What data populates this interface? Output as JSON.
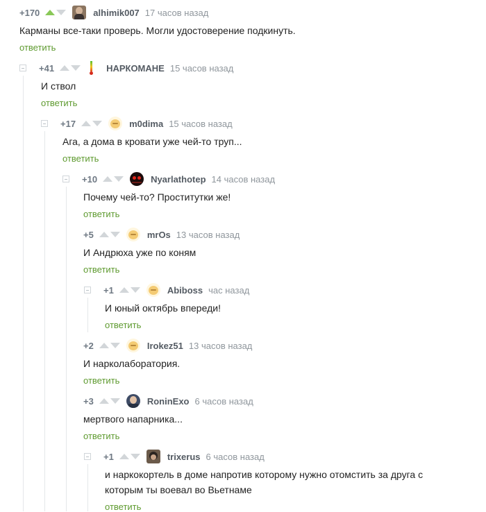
{
  "reply_label": "ответить",
  "colors": {
    "upvote_active": "#8ac858",
    "reply_link": "#5e9a2f",
    "branch_line": "#e4e7e9"
  },
  "comments": [
    {
      "rating": "+170",
      "author": "alhimik007",
      "time": "17 часов назад",
      "avatar": "photo-avatar",
      "upvoted": true,
      "lines": [
        "Карманы все-таки проверь. Могли удостоверение подкинуть."
      ]
    },
    {
      "rating": "+41",
      "author": "НАРКОМАНЕ",
      "time": "15 часов назад",
      "avatar": "thermometer-avatar",
      "lines": [
        "И ствол"
      ]
    },
    {
      "rating": "+17",
      "author": "m0dima",
      "time": "15 часов назад",
      "avatar": "default-avatar",
      "lines": [
        "Ага, а дома в кровати уже чей-то труп..."
      ]
    },
    {
      "rating": "+10",
      "author": "Nyarlathotep",
      "time": "14 часов назад",
      "avatar": "red-eyes-avatar",
      "lines": [
        "Почему чей-то? Проститутки же!"
      ]
    },
    {
      "rating": "+5",
      "author": "mrOs",
      "time": "13 часов назад",
      "avatar": "default-avatar",
      "lines": [
        "И Андрюха уже по коням"
      ]
    },
    {
      "rating": "+1",
      "author": "Abiboss",
      "time": "час назад",
      "avatar": "default-avatar",
      "lines": [
        "И юный октябрь впереди!"
      ]
    },
    {
      "rating": "+2",
      "author": "Irokez51",
      "time": "13 часов назад",
      "avatar": "default-avatar",
      "lines": [
        "И нарколаборатория."
      ]
    },
    {
      "rating": "+3",
      "author": "RoninExo",
      "time": "6 часов назад",
      "avatar": "photo-avatar",
      "lines": [
        "мертвого напарника..."
      ]
    },
    {
      "rating": "+1",
      "author": "trixerus",
      "time": "6 часов назад",
      "avatar": "photo-avatar",
      "lines": [
        "и наркокортель в доме напротив которому нужно отомстить за друга с",
        "которым ты воевал во Вьетнаме"
      ]
    }
  ]
}
